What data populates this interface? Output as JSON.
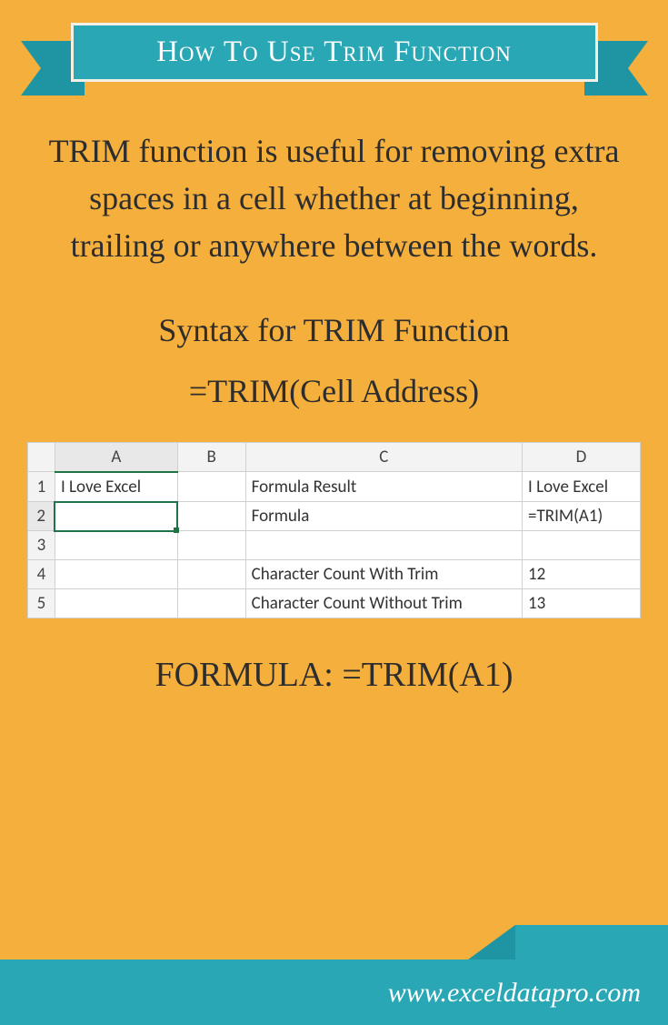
{
  "header": {
    "title": "How To Use Trim Function"
  },
  "description": "TRIM function is useful for removing extra spaces in a cell whether at beginning, trailing or anywhere between the words.",
  "syntax": {
    "label": "Syntax for TRIM Function",
    "formula": "=TRIM(Cell Address)"
  },
  "spreadsheet": {
    "columns": [
      "A",
      "B",
      "C",
      "D"
    ],
    "row_headers": [
      "1",
      "2",
      "3",
      "4",
      "5"
    ],
    "rows": [
      {
        "A": "I Love Excel",
        "B": "",
        "C": "Formula Result",
        "D": "I Love Excel"
      },
      {
        "A": "",
        "B": "",
        "C": "Formula",
        "D": "=TRIM(A1)"
      },
      {
        "A": "",
        "B": "",
        "C": "",
        "D": ""
      },
      {
        "A": "",
        "B": "",
        "C": "Character Count With Trim",
        "D": "12"
      },
      {
        "A": "",
        "B": "",
        "C": "Character Count Without Trim",
        "D": "13"
      }
    ]
  },
  "formula_line": "FORMULA: =TRIM(A1)",
  "footer": {
    "url": "www.exceldatapro.com"
  }
}
